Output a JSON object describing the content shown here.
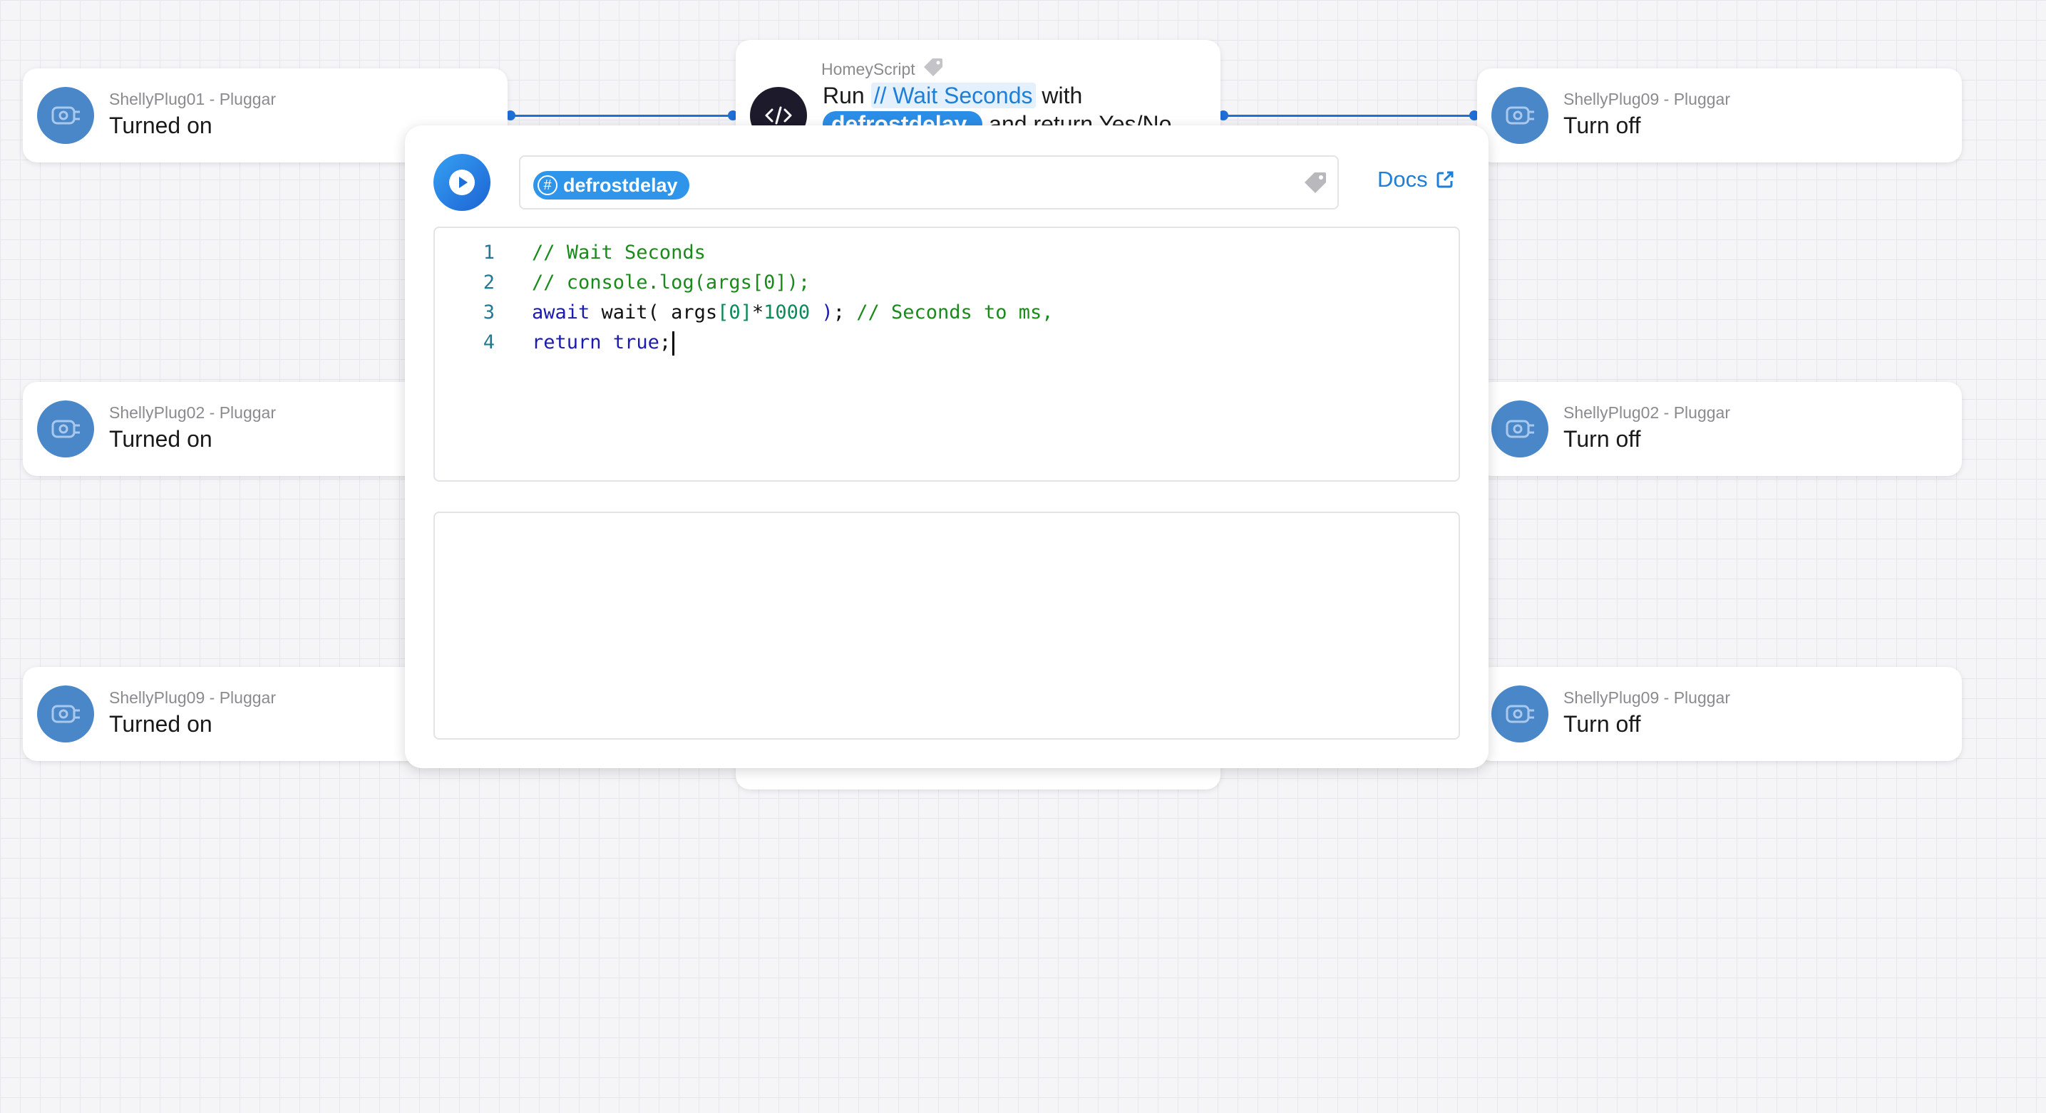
{
  "nodes_left": [
    {
      "device": "ShellyPlug01 - Pluggar",
      "action": "Turned on"
    },
    {
      "device": "ShellyPlug02 - Pluggar",
      "action": "Turned on"
    },
    {
      "device": "ShellyPlug09 - Pluggar",
      "action": "Turned on"
    }
  ],
  "nodes_right": [
    {
      "device": "ShellyPlug09 - Pluggar",
      "action": "Turn off"
    },
    {
      "device": "ShellyPlug02 - Pluggar",
      "action": "Turn off"
    },
    {
      "device": "ShellyPlug09 - Pluggar",
      "action": "Turn off"
    }
  ],
  "homeyscript": {
    "title": "HomeyScript",
    "run_word": "Run",
    "script_name": "// Wait Seconds",
    "with_word": "with",
    "arg_partial": "defrostdelay",
    "return_text": "and return Yes/No"
  },
  "editor": {
    "argument_tag": "defrostdelay",
    "docs_label": "Docs",
    "code": [
      {
        "n": "1",
        "parts": [
          {
            "t": "// Wait Seconds",
            "c": "comment"
          }
        ]
      },
      {
        "n": "2",
        "parts": [
          {
            "t": "// console.log(args[0]);",
            "c": "comment"
          }
        ]
      },
      {
        "n": "3",
        "parts": [
          {
            "t": "await",
            "c": "kw"
          },
          {
            "t": " wait( args",
            "c": "plain"
          },
          {
            "t": "[0]",
            "c": "num"
          },
          {
            "t": "*",
            "c": "plain"
          },
          {
            "t": "1000",
            "c": "num"
          },
          {
            "t": " )",
            "c": "kw"
          },
          {
            "t": "; ",
            "c": "plain"
          },
          {
            "t": "// Seconds to ms,",
            "c": "comment"
          }
        ]
      },
      {
        "n": "4",
        "parts": [
          {
            "t": "return",
            "c": "kw"
          },
          {
            "t": " ",
            "c": "plain"
          },
          {
            "t": "true",
            "c": "kw"
          },
          {
            "t": ";",
            "c": "plain"
          }
        ],
        "cursor": true
      }
    ]
  },
  "colors": {
    "accent": "#1e7fd8",
    "node_icon": "#4a87c9",
    "connector": "#1f6fd6"
  },
  "icons": {
    "device": "plug-icon",
    "script": "code-icon",
    "run": "play-icon",
    "tag": "tag-icon",
    "external": "external-link-icon"
  }
}
